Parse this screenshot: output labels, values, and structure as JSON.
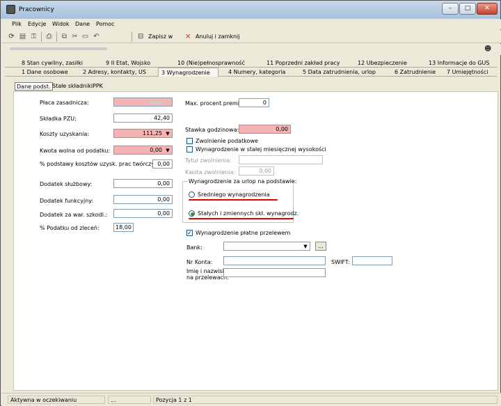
{
  "window": {
    "title": "Pracownicy"
  },
  "menu": [
    "Plik",
    "Edycje",
    "Widok",
    "Dane",
    "Pomoc"
  ],
  "toolbar": {
    "save_label": "Zapisz w bazie",
    "cancel_label": "Anuluj i zamknij"
  },
  "tabs_row1": [
    {
      "key": "8",
      "label": "Stan cywilny, zasiłki"
    },
    {
      "key": "9",
      "label": "II Etat, Wojsko"
    },
    {
      "key": "10",
      "label": "(Nie)pełnosprawność"
    },
    {
      "key": "11",
      "label": "Poprzedni zakład pracy"
    },
    {
      "key": "12",
      "label": "Ubezpieczenie"
    },
    {
      "key": "13",
      "label": "Informacje do GUS"
    }
  ],
  "tabs_row2": [
    {
      "key": "1",
      "label": "Dane osobowe"
    },
    {
      "key": "2",
      "label": "Adresy, kontakty, US"
    },
    {
      "key": "3",
      "label": "Wynagrodzenie"
    },
    {
      "key": "4",
      "label": "Numery, kategoria"
    },
    {
      "key": "5",
      "label": "Data zatrudnienia, urlop"
    },
    {
      "key": "6",
      "label": "Zatrudnienie"
    },
    {
      "key": "7",
      "label": "Umiejętności"
    }
  ],
  "subtabs": [
    "Dane podst.",
    "Stałe składniki",
    "PPK"
  ],
  "left_fields": {
    "placa_label": "Płaca zasadnicza:",
    "placa_value": "",
    "pzu_label": "Składka PZU:",
    "pzu_value": "42,40",
    "koszty_label": "Koszty uzyskania:",
    "koszty_value": "111,25",
    "kwota_label": "Kwota wolna od podatku:",
    "kwota_value": "0,00",
    "procent_label": "% podstawy kosztów uzysk. prac twórczych:",
    "procent_value": "0,00",
    "sluzbowy_label": "Dodatek służbowy:",
    "sluzbowy_value": "0,00",
    "funkcyjny_label": "Dodatek funkcyjny:",
    "funkcyjny_value": "0,00",
    "szkodl_label": "Dodatek za war. szkodl.:",
    "szkodl_value": "0,00",
    "zlecen_label": "% Podatku od zleceń:",
    "zlecen_value": "18,00"
  },
  "right_fields": {
    "premia_label": "Max. procent premii:",
    "premia_value": "0",
    "stawka_label": "Stawka godzinowa:",
    "stawka_value": "0,00",
    "zwolnienie_label": "Zwolnienie podatkowe",
    "stala_label": "Wynagrodzenie w stałej miesięcznej wysokości",
    "tytul_label": "Tytuł zwolnienia:",
    "kwota_zw_label": "Kwota zwolnienia:",
    "kwota_zw_value": "0,00",
    "urlop_title": "Wynagrodzenie za urlop na podstawie:",
    "urlop_opt1": "Średniego wynagrodzenia",
    "urlop_opt2": "Stałych i zmiennych skł. wynagrodz.",
    "przelew_label": "Wynagrodzenie płatne przelewem",
    "bank_label": "Bank:",
    "bank_btn": "...",
    "konto_label": "Nr Konta:",
    "swift_label": "SWIFT:",
    "imie_label_1": "Imię i nazwisko",
    "imie_label_2": "na przelewach:"
  },
  "status": {
    "state": "Aktywna w oczekiwaniu",
    "mid": "...",
    "position": "Pozycja 1 z 1"
  },
  "colors": {
    "required_field": "#f5b3b3",
    "annotation_red": "#e00000"
  }
}
